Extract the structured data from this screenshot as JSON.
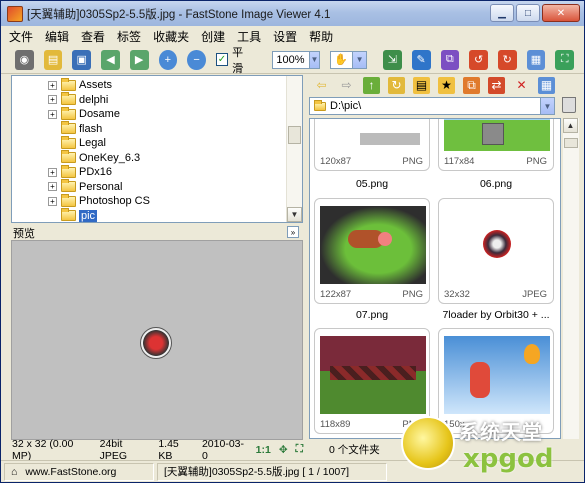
{
  "window": {
    "title": "[天翼辅助]0305Sp2-5.5版.jpg - FastStone Image Viewer 4.1",
    "buttons": {
      "minimize": "▁",
      "maximize": "□",
      "close": "✕"
    }
  },
  "menu": [
    "文件",
    "编辑",
    "查看",
    "标签",
    "收藏夹",
    "创建",
    "工具",
    "设置",
    "帮助"
  ],
  "toolbar": {
    "smooth_label": "平滑",
    "smooth_checked": "✓",
    "zoom_value": "100%",
    "hand_tool": "✋"
  },
  "tree": {
    "items": [
      {
        "label": "Assets",
        "expandable": "+"
      },
      {
        "label": "delphi",
        "expandable": "+"
      },
      {
        "label": "Dosame",
        "expandable": "+"
      },
      {
        "label": "flash",
        "expandable": ""
      },
      {
        "label": "Legal",
        "expandable": ""
      },
      {
        "label": "OneKey_6.3",
        "expandable": ""
      },
      {
        "label": "PDx16",
        "expandable": "+"
      },
      {
        "label": "Personal",
        "expandable": "+"
      },
      {
        "label": "Photoshop CS",
        "expandable": "+"
      },
      {
        "label": "pic",
        "expandable": ""
      }
    ]
  },
  "preview": {
    "header": "预览",
    "collapse": "»"
  },
  "image_status": {
    "dims": "32 x 32 (0.00 MP)",
    "bit": "24bit JPEG",
    "size": "1.45 KB",
    "date": "2010-03-0",
    "ratio": "1:1"
  },
  "browser": {
    "path": "D:\\pic\\",
    "folder_count": "0 个文件夹"
  },
  "thumbnails": [
    {
      "dims": "120x87",
      "format": "PNG",
      "name": "05.png"
    },
    {
      "dims": "117x84",
      "format": "PNG",
      "name": "06.png"
    },
    {
      "dims": "122x87",
      "format": "PNG",
      "name": "07.png"
    },
    {
      "dims": "32x32",
      "format": "JPEG",
      "name": "7loader by Orbit30 + ..."
    },
    {
      "dims": "118x89",
      "format": "PNG",
      "name": ""
    },
    {
      "dims": "150x",
      "format": "",
      "name": ""
    }
  ],
  "bottom": {
    "site": "www.FastStone.org",
    "file_info": "[天翼辅助]0305Sp2-5.5版.jpg [ 1 / 1007]"
  },
  "watermark": {
    "text_top": "系统天堂",
    "text_bottom": "xpgod"
  }
}
